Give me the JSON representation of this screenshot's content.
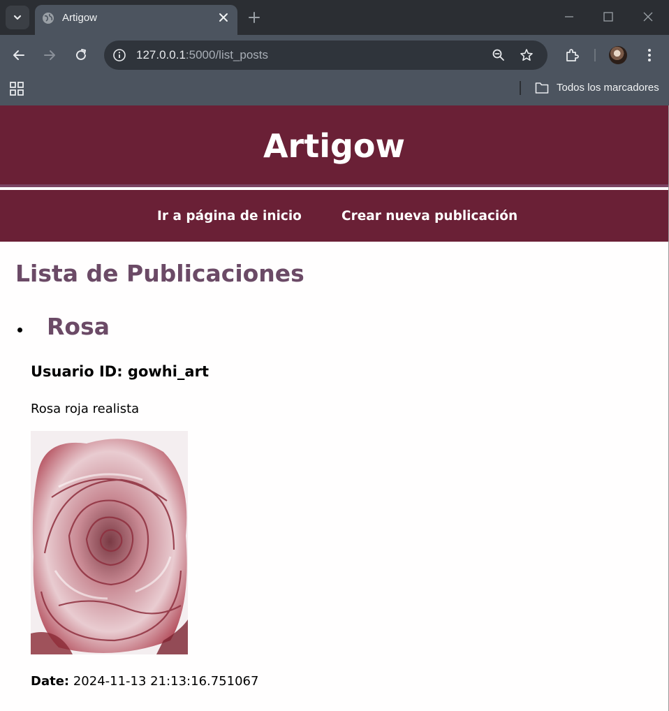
{
  "browser": {
    "tab_title": "Artigow",
    "url_host": "127.0.0.1",
    "url_path": ":5000/list_posts",
    "bookmarks_folder": "Todos los marcadores"
  },
  "site": {
    "title": "Artigow",
    "nav": [
      {
        "label": "Ir a página de inicio"
      },
      {
        "label": "Crear nueva publicación"
      }
    ]
  },
  "main": {
    "heading": "Lista de Publicaciones",
    "posts": [
      {
        "title": "Rosa",
        "user_line": "Usuario ID: gowhi_art",
        "description": "Rosa roja realista",
        "image_icon": "rose-drawing",
        "date_label": "Date:",
        "date_value": "2024-11-13 21:13:16.751067"
      }
    ]
  },
  "colors": {
    "header_bg": "#6a2036",
    "header_divider": "#7b4463",
    "heading_color": "#6b4a66",
    "chrome_bg": "#4c545f"
  }
}
